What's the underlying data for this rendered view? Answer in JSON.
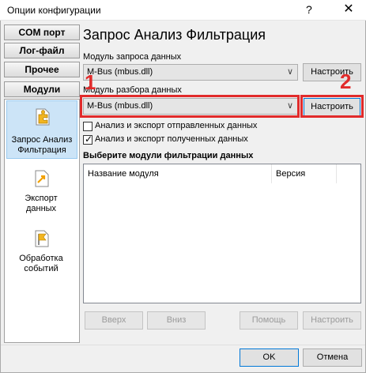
{
  "window": {
    "title": "Опции конфигурации",
    "help": "?",
    "close": "✕"
  },
  "tabs": [
    "COM порт",
    "Лог-файл",
    "Прочее",
    "Модули"
  ],
  "sidebar": {
    "items": [
      {
        "line1": "Запрос Анализ",
        "line2": "Фильтрация",
        "icon": "puzzle-piece-icon",
        "selected": true
      },
      {
        "line1": "Экспорт",
        "line2": "данных",
        "icon": "export-arrow-icon",
        "selected": false
      },
      {
        "line1": "Обработка",
        "line2": "событий",
        "icon": "flag-icon",
        "selected": false
      }
    ]
  },
  "main": {
    "title": "Запрос Анализ Фильтрация",
    "request_module": {
      "label": "Модуль запроса данных",
      "value": "M-Bus (mbus.dll)",
      "button": "Настроить"
    },
    "parse_module": {
      "label": "Модуль разбора данных",
      "value": "M-Bus (mbus.dll)",
      "button": "Настроить"
    },
    "checkbox_sent": {
      "label": "Анализ и экспорт отправленных данных",
      "checked": false
    },
    "checkbox_received": {
      "label": "Анализ и экспорт полученных данных",
      "checked": true
    },
    "filter_heading": "Выберите модули фильтрации данных",
    "filter_columns": {
      "name": "Название модуля",
      "version": "Версия"
    },
    "bottom_buttons": {
      "up": "Вверх",
      "down": "Вниз",
      "help": "Помощь",
      "configure": "Настроить"
    }
  },
  "footer": {
    "ok": "OK",
    "cancel": "Отмена"
  },
  "annotations": {
    "one": "1",
    "two": "2",
    "color": "#e12b2b"
  },
  "colors": {
    "selection_bg": "#cce4f7",
    "highlight_red": "#e12b2b",
    "focus_blue": "#0078d7"
  }
}
